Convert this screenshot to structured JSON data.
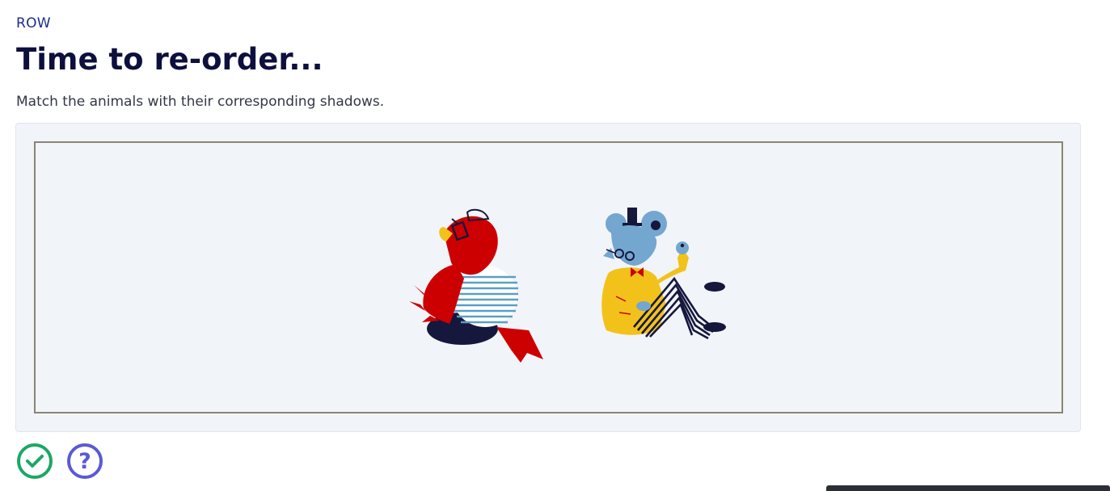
{
  "header": {
    "eyebrow": "ROW",
    "title": "Time to re-order...",
    "instruction": "Match the animals with their corresponding shadows."
  },
  "activity": {
    "items": [
      {
        "id": "parrot",
        "icon": "parrot-illustration"
      },
      {
        "id": "mouse",
        "icon": "mouse-illustration"
      }
    ]
  },
  "actions": {
    "check_icon": "check-circle-icon",
    "help_icon": "help-circle-icon",
    "help_glyph": "?"
  },
  "colors": {
    "heading": "#0d0f3d",
    "eyebrow": "#1d2d8a",
    "panel_bg": "#f1f4f9",
    "check": "#1aa865",
    "help": "#5a5ad6"
  }
}
